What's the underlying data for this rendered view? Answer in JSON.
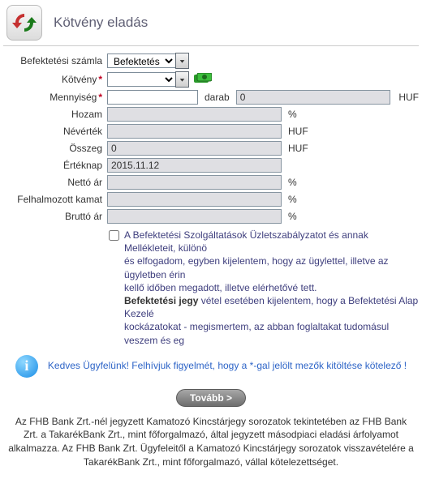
{
  "page_title": "Kötvény eladás",
  "labels": {
    "account": "Befektetési számla",
    "bond": "Kötvény",
    "quantity": "Mennyiség",
    "quantity_unit": "darab",
    "yield": "Hozam",
    "face_value": "Névérték",
    "amount": "Összeg",
    "value_day": "Értéknap",
    "net_price": "Nettó ár",
    "accrued_interest": "Felhalmozott kamat",
    "gross_price": "Bruttó ár"
  },
  "fields": {
    "account": "Befektetési",
    "bond": "",
    "quantity": "",
    "quantity_calc": "0",
    "yield": "",
    "face_value": "",
    "amount": "0",
    "value_day": "2015.11.12",
    "net_price": "",
    "accrued_interest": "",
    "gross_price": ""
  },
  "units": {
    "quantity_calc": "HUF",
    "yield": "%",
    "face_value": "HUF",
    "amount": "HUF",
    "net_price": "%",
    "accrued_interest": "%",
    "gross_price": "%"
  },
  "agreement": {
    "line1": "A Befektetési Szolgáltatások Üzletszabályzatot és annak Mellékleteit, különö",
    "line2": "és elfogadom, egyben kijelentem, hogy az ügylettel, illetve az ügyletben érin",
    "line3": "kellő időben megadott, illetve elérhetővé tett.",
    "line4_bold": "Befektetési jegy",
    "line4_rest": " vétel esetében kijelentem, hogy a Befektetési Alap Kezelé",
    "line5": "kockázatokat - megismertem, az abban foglaltakat tudomásul veszem és eg"
  },
  "info": "Kedves Ügyfelünk! Felhívjuk figyelmét, hogy a *-gal jelölt mezők kitöltése kötelező !",
  "button_next": "Tovább >",
  "footer": "Az FHB Bank Zrt.-nél jegyzett Kamatozó Kincstárjegy sorozatok tekintetében az FHB Bank Zrt. a TakarékBank Zrt., mint főforgalmazó, által jegyzett másodpiaci eladási árfolyamot alkalmazza. Az FHB Bank Zrt. Ügyfeleitől a Kamatozó Kincstárjegy sorozatok visszavételére a TakarékBank Zrt., mint főforgalmazó, vállal kötelezettséget."
}
